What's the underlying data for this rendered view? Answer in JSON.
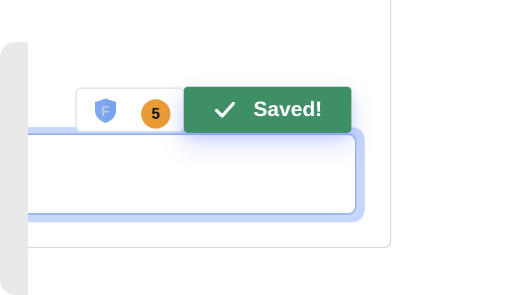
{
  "editor": {
    "value": ""
  },
  "extension_badge": {
    "icon": "shield-icon",
    "letter": "F",
    "count": "5"
  },
  "toast": {
    "icon": "check-icon",
    "label": "Saved!"
  },
  "colors": {
    "toast_background": "#3f8f66",
    "badge_background": "#eb9b34",
    "focus_ring": "#c7d6fb",
    "field_border": "#8eaef0",
    "shield": "#7ea9ef"
  }
}
